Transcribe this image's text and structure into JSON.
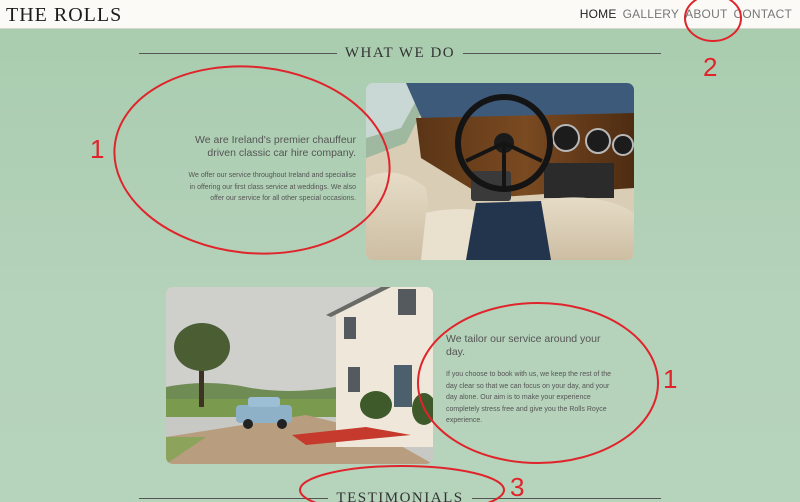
{
  "brand": "THE ROLLS",
  "nav": [
    "HOME",
    "GALLERY",
    "ABOUT",
    "CONTACT"
  ],
  "sections": {
    "what_we_do": "WHAT WE DO",
    "testimonials": "TESTIMONIALS"
  },
  "block1": {
    "lead": "We are Ireland's premier chauffeur driven classic car hire company.",
    "body": "We offer our service throughout Ireland and specialise in offering our first class service at weddings. We also offer our service for all other special occasions."
  },
  "block2": {
    "lead": "We tailor our service around your day.",
    "body": "If you choose to book with us, we keep the rest of the day clear so that we can focus on your day, and your day alone. Our aim is to make your experience completely stress free and give you the Rolls Royce experience."
  },
  "annotations": {
    "n1a": "1",
    "n1b": "1",
    "n2": "2",
    "n3": "3"
  },
  "colors": {
    "page_bg": "#b3d1b8",
    "navbar_bg": "#fbfaf6",
    "annotation_red": "#e0242b"
  }
}
